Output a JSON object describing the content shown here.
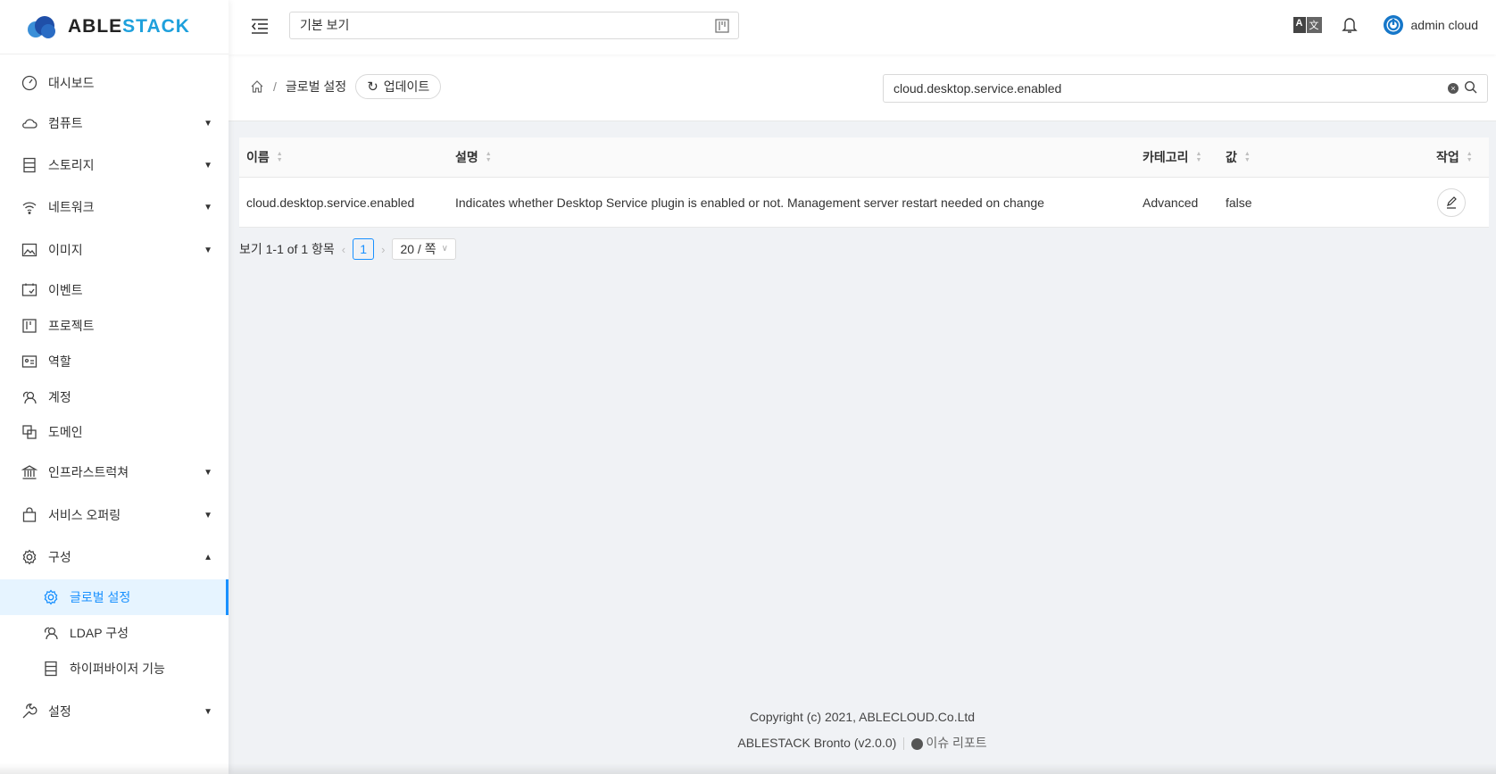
{
  "brand": {
    "part1": "ABLE",
    "part2": "STACK"
  },
  "sidebar": {
    "items": [
      {
        "label": "대시보드",
        "icon": "dashboard-icon"
      },
      {
        "label": "컴퓨트",
        "icon": "cloud-icon",
        "expand": "v"
      },
      {
        "label": "스토리지",
        "icon": "storage-icon",
        "expand": "v"
      },
      {
        "label": "네트워크",
        "icon": "wifi-icon",
        "expand": "v"
      },
      {
        "label": "이미지",
        "icon": "picture-icon",
        "expand": "v"
      },
      {
        "label": "이벤트",
        "icon": "schedule-icon"
      },
      {
        "label": "프로젝트",
        "icon": "project-icon"
      },
      {
        "label": "역할",
        "icon": "idcard-icon"
      },
      {
        "label": "계정",
        "icon": "team-icon"
      },
      {
        "label": "도메인",
        "icon": "block-icon"
      },
      {
        "label": "인프라스트럭쳐",
        "icon": "bank-icon",
        "expand": "v"
      },
      {
        "label": "서비스 오퍼링",
        "icon": "shopping-icon",
        "expand": "v"
      },
      {
        "label": "구성",
        "icon": "setting-icon",
        "expand": "^"
      },
      {
        "label": "글로벌 설정",
        "icon": "setting-icon"
      },
      {
        "label": "LDAP 구성",
        "icon": "team-icon"
      },
      {
        "label": "하이퍼바이저 기능",
        "icon": "storage-icon"
      },
      {
        "label": "설정",
        "icon": "tool-icon",
        "expand": "v"
      }
    ]
  },
  "header": {
    "view_select": "기본 보기",
    "user": "admin cloud"
  },
  "breadcrumb": {
    "current": "글로벌 설정",
    "separator": "/",
    "refresh_label": "업데이트"
  },
  "search": {
    "value": "cloud.desktop.service.enabled"
  },
  "table": {
    "columns": [
      "이름",
      "설명",
      "카테고리",
      "값",
      "작업"
    ],
    "rows": [
      {
        "name": "cloud.desktop.service.enabled",
        "description": "Indicates whether Desktop Service plugin is enabled or not. Management server restart needed on change",
        "category": "Advanced",
        "value": "false"
      }
    ]
  },
  "pagination": {
    "summary": "보기 1-1 of 1 항목",
    "current_page": "1",
    "page_size": "20 / 쪽"
  },
  "footer": {
    "copyright": "Copyright (c) 2021, ABLECLOUD.Co.Ltd",
    "version": "ABLESTACK Bronto (v2.0.0)",
    "issue_link": "이슈 리포트"
  },
  "colors": {
    "accent": "#1890ff",
    "logo_blue": "#1ea0dc"
  }
}
